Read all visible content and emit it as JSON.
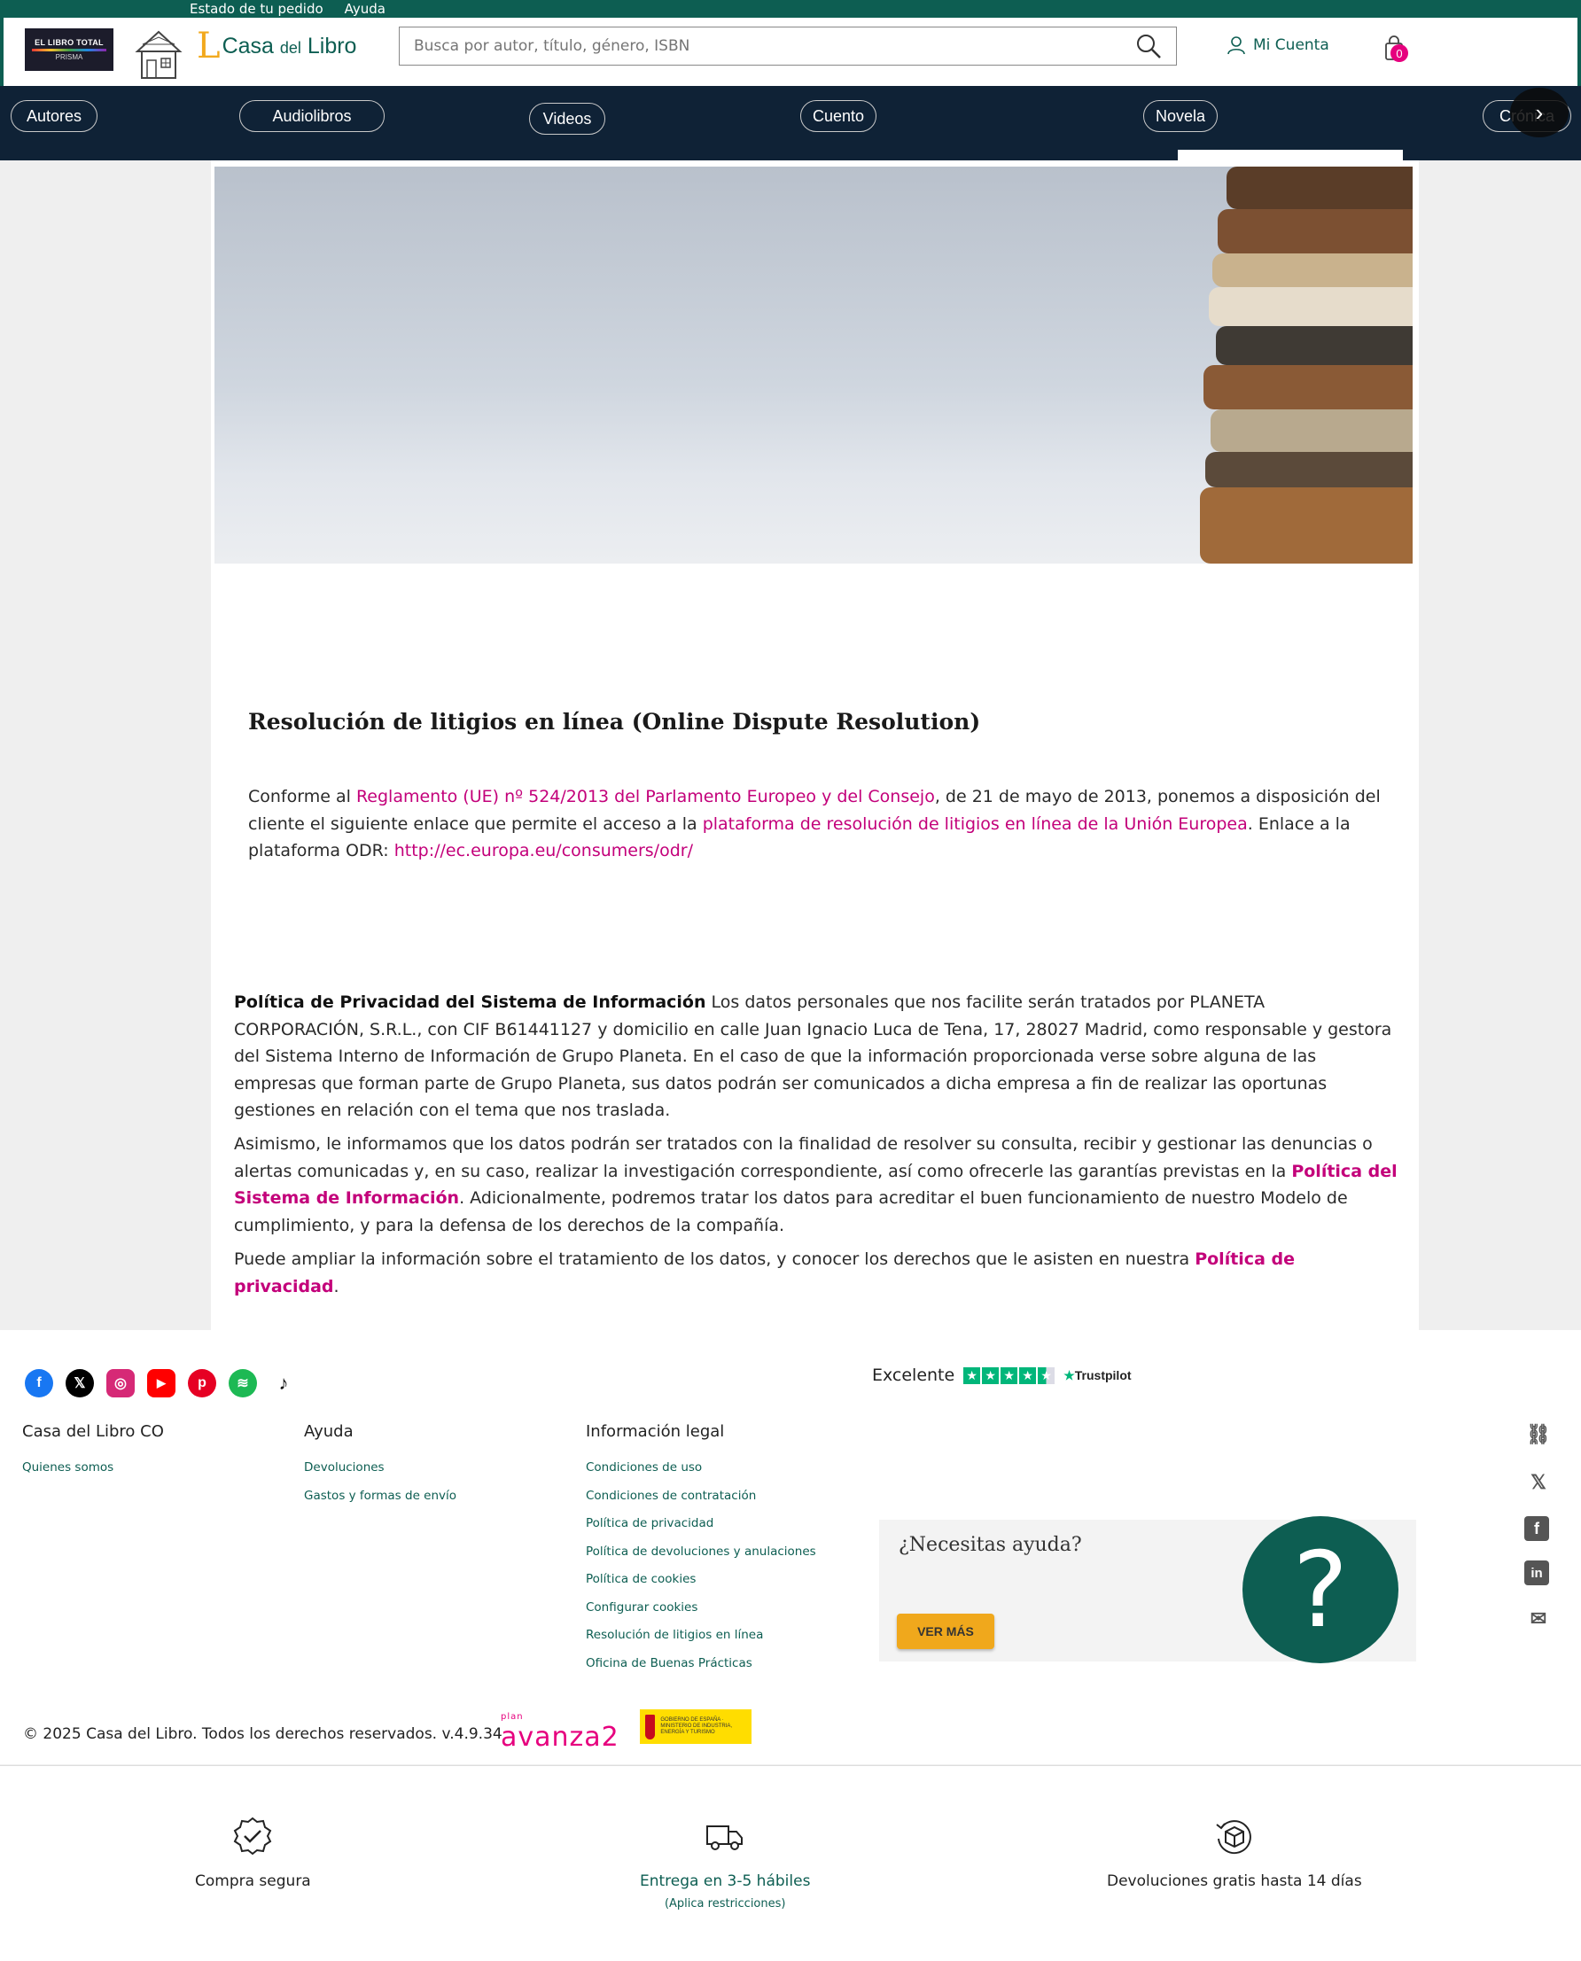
{
  "topbar": {
    "links": [
      "Estado de tu pedido",
      "Ayuda"
    ]
  },
  "header": {
    "libro_total": {
      "line1": "EL LIBRO TOTAL",
      "line2": "PRISMA"
    },
    "logo": {
      "letter": "L",
      "name_main": "Casa",
      "name_small": "del",
      "name_end": "Libro"
    },
    "search": {
      "placeholder": "Busca por autor, título, género, ISBN"
    },
    "account_label": "Mi Cuenta",
    "cart_count": "0"
  },
  "categories": [
    "Autores",
    "Audiolibros",
    "Videos",
    "Cuento",
    "Novela",
    "Crónica"
  ],
  "article": {
    "title": "Resolución de litigios en línea (Online Dispute Resolution)",
    "p1": {
      "t1": "Conforme al ",
      "link1": "Reglamento (UE) nº 524/2013 del Parlamento Europeo y del Consejo",
      "t2": ", de 21 de mayo de 2013, ponemos a disposición del cliente el siguiente enlace que permite el acceso a la ",
      "link2": "plataforma de resolución de litigios en línea de la Unión Europea",
      "t3": ". Enlace a la plataforma ODR: ",
      "link3": "http://ec.europa.eu/consumers/odr/"
    },
    "p2": {
      "bold": "Política de Privacidad del Sistema de Información",
      "text": " Los datos personales que nos facilite serán tratados por PLANETA CORPORACIÓN, S.R.L., con CIF B61441127 y domicilio en calle Juan Ignacio Luca de Tena, 17, 28027 Madrid, como responsable y gestora del Sistema Interno de Información de Grupo Planeta. En el caso de que la información proporcionada verse sobre alguna de las empresas que forman parte de Grupo Planeta, sus datos podrán ser comunicados a dicha empresa a fin de realizar las oportunas gestiones en relación con el tema que nos traslada."
    },
    "p3": {
      "t1": "Asimismo, le informamos que los datos podrán ser tratados con la finalidad de resolver su consulta, recibir y gestionar las denuncias o alertas comunicadas y, en su caso, realizar la investigación correspondiente, así como ofrecerle las garantías previstas en la ",
      "link": "Política del Sistema de Información",
      "t2": ". Adicionalmente, podremos tratar los datos para acreditar el buen funcionamiento de nuestro Modelo de cumplimiento, y para la defensa de los derechos de la compañía."
    },
    "p4": {
      "t1": "Puede ampliar la información sobre el tratamiento de los datos, y conocer los derechos que le asisten en nuestra ",
      "link": "Política de privacidad",
      "t2": "."
    }
  },
  "footer": {
    "social": [
      {
        "icon": "facebook-icon",
        "glyph": "f",
        "color": "#1877f2"
      },
      {
        "icon": "x-icon",
        "glyph": "𝕏",
        "color": "#000000"
      },
      {
        "icon": "instagram-icon",
        "glyph": "◎",
        "color": "#d62976"
      },
      {
        "icon": "youtube-icon",
        "glyph": "▶",
        "color": "#ff0000"
      },
      {
        "icon": "pinterest-icon",
        "glyph": "p",
        "color": "#e60023"
      },
      {
        "icon": "spotify-icon",
        "glyph": "≋",
        "color": "#1db954"
      },
      {
        "icon": "tiktok-icon",
        "glyph": "♪",
        "color": "#111111"
      }
    ],
    "trustpilot": {
      "rating": "Excelente",
      "brand": "Trustpilot"
    },
    "columns": [
      {
        "heading": "Casa del Libro CO",
        "items": [
          "Quienes somos"
        ]
      },
      {
        "heading": "Ayuda",
        "items": [
          "Devoluciones",
          "Gastos y formas de envío"
        ]
      },
      {
        "heading": "Información legal",
        "items": [
          "Condiciones de uso",
          "Condiciones de contratación",
          "Política de privacidad",
          "Política de devoluciones y anulaciones",
          "Política de cookies",
          "Configurar cookies",
          "Resolución de litigios en línea",
          "Oficina de Buenas Prácticas"
        ]
      }
    ],
    "help": {
      "question": "¿Necesitas ayuda?",
      "button": "VER MÁS",
      "symbol": "?"
    },
    "copyright": "© 2025 Casa del Libro. Todos los derechos reservados. v.4.9.34",
    "avanza": {
      "small": "plan",
      "big": "avanza2"
    },
    "gov": "GOBIERNO DE ESPAÑA · MINISTERIO DE INDUSTRIA, ENERGÍA Y TURISMO"
  },
  "features": [
    {
      "label": "Compra segura",
      "sub": ""
    },
    {
      "label": "Entrega en 3-5 hábiles",
      "sub": "(Aplica restricciones)"
    },
    {
      "label": "Devoluciones gratis hasta 14 días",
      "sub": ""
    }
  ],
  "colors": {
    "brand_green": "#0d5e52",
    "nav_dark": "#0f2236",
    "accent_pink": "#c3007a",
    "accent_orange": "#f0a81c",
    "trust_green": "#00b67a"
  }
}
